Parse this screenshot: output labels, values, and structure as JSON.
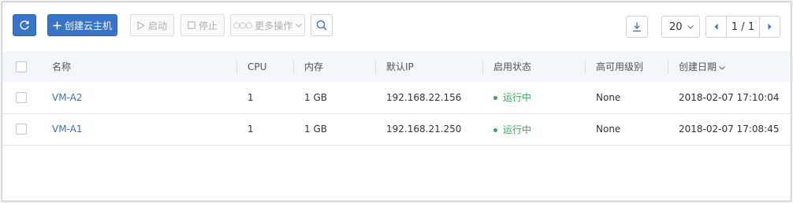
{
  "toolbar": {
    "create_label": "创建云主机",
    "start_label": "启动",
    "stop_label": "停止",
    "more_label": "更多操作",
    "page_size": "20",
    "page_info": "1 / 1"
  },
  "table": {
    "columns": [
      "名称",
      "CPU",
      "内存",
      "默认IP",
      "启用状态",
      "高可用级别",
      "创建日期"
    ],
    "rows": [
      {
        "name": "VM-A2",
        "cpu": "1",
        "memory": "1 GB",
        "ip": "192.168.22.156",
        "status": "运行中",
        "ha": "None",
        "created": "2018-02-07 17:10:04"
      },
      {
        "name": "VM-A1",
        "cpu": "1",
        "memory": "1 GB",
        "ip": "192.168.21.250",
        "status": "运行中",
        "ha": "None",
        "created": "2018-02-07 17:08:45"
      }
    ]
  },
  "colors": {
    "primary": "#3a74c6",
    "running": "#3aaa5a"
  },
  "icons": [
    "refresh-icon",
    "plus-icon",
    "play-icon",
    "stop-icon",
    "dots-icon",
    "chevron-down-icon",
    "search-icon",
    "download-icon",
    "chevron-left-icon",
    "chevron-right-icon"
  ]
}
